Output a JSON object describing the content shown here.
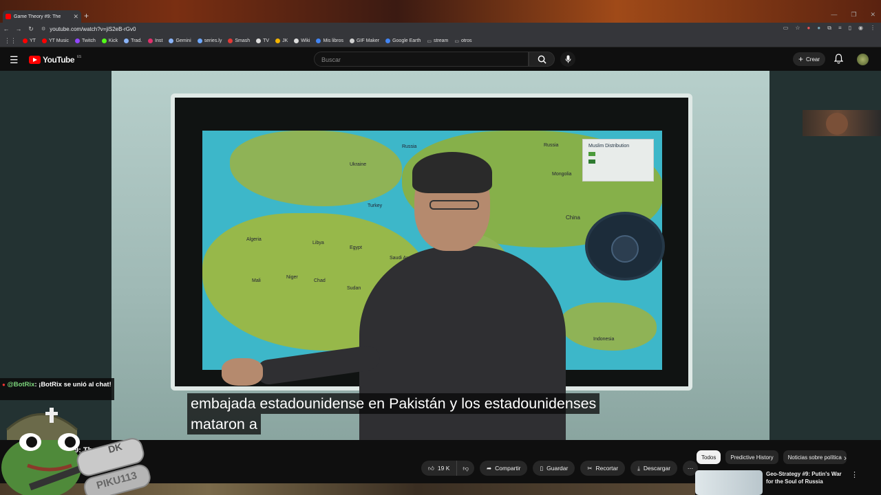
{
  "browser": {
    "tab_title": "Game Theory #9: The",
    "url": "youtube.com/watch?v=jiS2eB-rGv0",
    "bookmarks": [
      {
        "label": "YT",
        "color": "#ff0000"
      },
      {
        "label": "YT Music",
        "color": "#ff0000"
      },
      {
        "label": "Twitch",
        "color": "#9146ff"
      },
      {
        "label": "Kick",
        "color": "#53fc18"
      },
      {
        "label": "Trad.",
        "color": "#8ab4f8"
      },
      {
        "label": "Inst",
        "color": "#e1306c"
      },
      {
        "label": "Gemini",
        "color": "#8ab4f8"
      },
      {
        "label": "series.ly",
        "color": "#6ea8ff"
      },
      {
        "label": "Smash",
        "color": "#e53935"
      },
      {
        "label": "TV",
        "color": "#dddddd"
      },
      {
        "label": "JK",
        "color": "#f4b400"
      },
      {
        "label": "Wiki",
        "color": "#dddddd"
      },
      {
        "label": "Mis libros",
        "color": "#4285f4"
      },
      {
        "label": "GIF Maker",
        "color": "#d0d0d0"
      },
      {
        "label": "Google Earth",
        "color": "#4285f4"
      },
      {
        "label": "stream",
        "color": "#bbbbbb"
      },
      {
        "label": "otros",
        "color": "#bbbbbb"
      }
    ]
  },
  "youtube": {
    "logo_text": "YouTube",
    "logo_region": "ES",
    "search_placeholder": "Buscar",
    "create_label": "Crear"
  },
  "video": {
    "legend_title": "Muslim Distribution",
    "map_labels": [
      "Russia",
      "Russia",
      "Mongolia",
      "China",
      "Algeria",
      "Libya",
      "Egypt",
      "Saudi Arabia",
      "Sudan",
      "Chad",
      "Niger",
      "Mali",
      "Turkey",
      "Ukraine",
      "Indonesia"
    ],
    "subtitle_line1": "embajada estadounidense en Pakistán y los estadounidenses",
    "subtitle_line2": "mataron a"
  },
  "chat_overlay": {
    "username": "@BotRix",
    "message": ": ¡BotRix se unió al chat!",
    "badge_name": "PIKU113"
  },
  "below_video": {
    "title_fragment": "9: Th",
    "title_fragment2": "r",
    "like_count": "19 K",
    "share_label": "Compartir",
    "save_label": "Guardar",
    "clip_label": "Recortar",
    "download_label": "Descargar"
  },
  "sidebar": {
    "chips": [
      "Todos",
      "Predictive History",
      "Noticias sobre política"
    ],
    "recommendation_title": "Geo-Strategy #9:  Putin's War for the Soul of Russia"
  }
}
